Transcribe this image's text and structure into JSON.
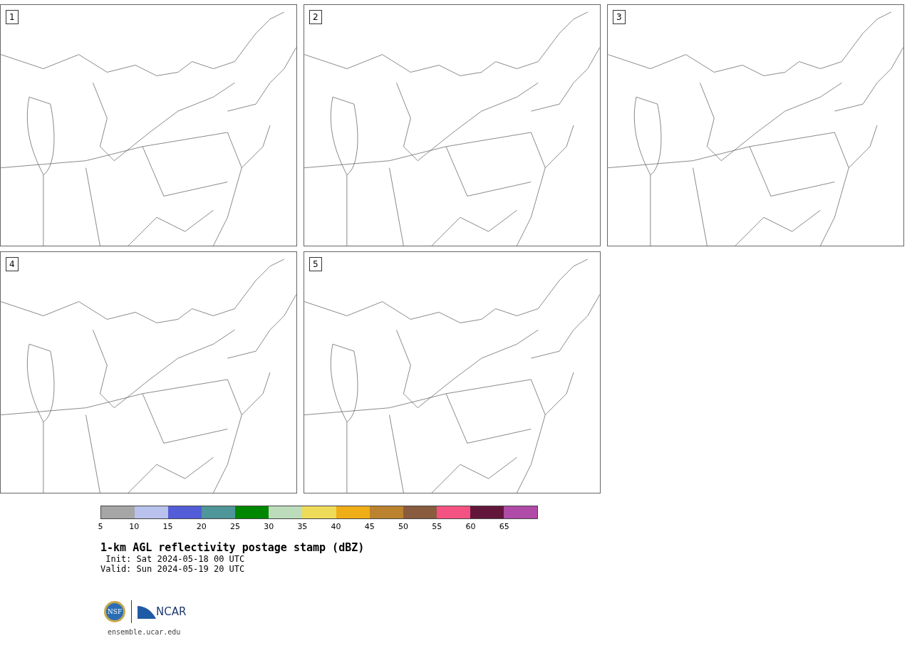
{
  "panels": [
    {
      "label": "1"
    },
    {
      "label": "2"
    },
    {
      "label": "3"
    },
    {
      "label": "4"
    },
    {
      "label": "5"
    }
  ],
  "colorbar": {
    "colors": [
      {
        "color": "#a6a6a6"
      },
      {
        "color": "#b8c2ec"
      },
      {
        "color": "#535dd8"
      },
      {
        "color": "#4f969a"
      },
      {
        "color": "#008700"
      },
      {
        "color": "#bddcbb"
      },
      {
        "color": "#efdb5a"
      },
      {
        "color": "#efad17"
      },
      {
        "color": "#bb832f"
      },
      {
        "color": "#895b3f"
      },
      {
        "color": "#f45282"
      },
      {
        "color": "#62173a"
      },
      {
        "color": "#b04ba8"
      }
    ],
    "ticks": [
      "5",
      "10",
      "15",
      "20",
      "25",
      "30",
      "35",
      "40",
      "45",
      "50",
      "55",
      "60",
      "65"
    ]
  },
  "title": "1-km AGL reflectivity postage stamp (dBZ)",
  "init": " Init: Sat 2024-05-18 00 UTC",
  "valid": "Valid: Sun 2024-05-19 20 UTC",
  "logo": {
    "left": "NSF",
    "right": "NCAR"
  },
  "footer": "ensemble.ucar.edu"
}
